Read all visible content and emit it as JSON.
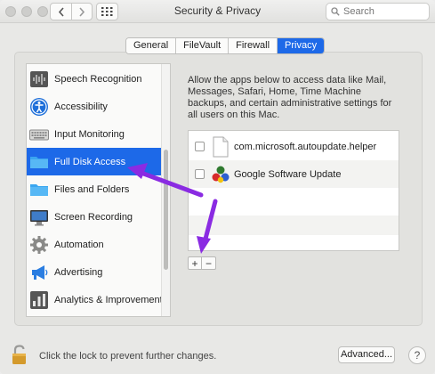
{
  "window": {
    "title": "Security & Privacy"
  },
  "search": {
    "placeholder": "Search"
  },
  "tabs": [
    {
      "label": "General",
      "active": false
    },
    {
      "label": "FileVault",
      "active": false
    },
    {
      "label": "Firewall",
      "active": false
    },
    {
      "label": "Privacy",
      "active": true
    }
  ],
  "sidebar": {
    "items": [
      {
        "label": "Speech Recognition",
        "icon": "waveform-icon",
        "selected": false
      },
      {
        "label": "Accessibility",
        "icon": "accessibility-icon",
        "selected": false
      },
      {
        "label": "Input Monitoring",
        "icon": "keyboard-icon",
        "selected": false
      },
      {
        "label": "Full Disk Access",
        "icon": "folder-icon",
        "selected": true
      },
      {
        "label": "Files and Folders",
        "icon": "folder-icon",
        "selected": false
      },
      {
        "label": "Screen Recording",
        "icon": "display-icon",
        "selected": false
      },
      {
        "label": "Automation",
        "icon": "gear-icon",
        "selected": false
      },
      {
        "label": "Advertising",
        "icon": "megaphone-icon",
        "selected": false
      },
      {
        "label": "Analytics & Improvements",
        "icon": "bar-chart-icon",
        "selected": false
      }
    ]
  },
  "main": {
    "description": "Allow the apps below to access data like Mail, Messages, Safari, Home, Time Machine backups, and certain administrative settings for all users on this Mac.",
    "apps": [
      {
        "name": "com.microsoft.autoupdate.helper",
        "checked": false,
        "icon": "document-icon"
      },
      {
        "name": "Google Software Update",
        "checked": false,
        "icon": "google-update-icon"
      }
    ],
    "add_label": "+",
    "remove_label": "−"
  },
  "footer": {
    "lock_text": "Click the lock to prevent further changes.",
    "advanced_label": "Advanced...",
    "help_label": "?"
  },
  "colors": {
    "accent": "#1d69e8",
    "arrow": "#8a2be2"
  }
}
